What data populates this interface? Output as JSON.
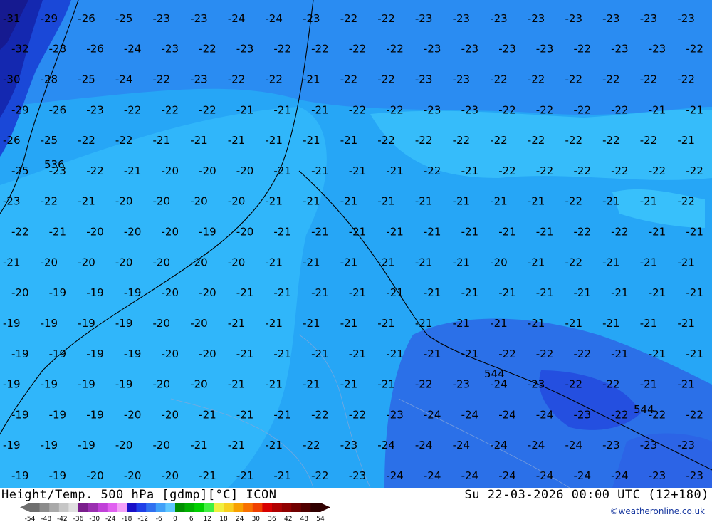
{
  "map": {
    "contour_labels": [
      [
        -31,
        -29,
        -26,
        -25,
        -23,
        -23,
        -24,
        -24,
        -23,
        -22,
        -22,
        -23,
        -23,
        -23,
        -23,
        -23,
        -23,
        -23,
        -23
      ],
      [
        -32,
        -28,
        -26,
        -24,
        -23,
        -22,
        -23,
        -22,
        -22,
        -22,
        -22,
        -23,
        -23,
        -23,
        -23,
        -22,
        -23,
        -23,
        -22
      ],
      [
        -30,
        -28,
        -25,
        -24,
        -22,
        -23,
        -22,
        -22,
        -21,
        -22,
        -22,
        -23,
        -23,
        -22,
        -22,
        -22,
        -22,
        -22,
        -22
      ],
      [
        -29,
        -26,
        -23,
        -22,
        -22,
        -22,
        -21,
        -21,
        -21,
        -22,
        -22,
        -23,
        -23,
        -22,
        -22,
        -22,
        -22,
        -21,
        -21
      ],
      [
        -26,
        -25,
        -22,
        -22,
        -21,
        -21,
        -21,
        -21,
        -21,
        -21,
        -22,
        -22,
        -22,
        -22,
        -22,
        -22,
        -22,
        -22,
        -21
      ],
      [
        -25,
        -23,
        -22,
        -21,
        -20,
        -20,
        -20,
        -21,
        -21,
        -21,
        -21,
        -22,
        -21,
        -22,
        -22,
        -22,
        -22,
        -22,
        -22
      ],
      [
        -23,
        -22,
        -21,
        -20,
        -20,
        -20,
        -20,
        -21,
        -21,
        -21,
        -21,
        -21,
        -21,
        -21,
        -21,
        -22,
        -21,
        -21,
        -22
      ],
      [
        -22,
        -21,
        -20,
        -20,
        -20,
        -19,
        -20,
        -21,
        -21,
        -21,
        -21,
        -21,
        -21,
        -21,
        -21,
        -22,
        -22,
        -21,
        -21
      ],
      [
        -21,
        -20,
        -20,
        -20,
        -20,
        -20,
        -20,
        -21,
        -21,
        -21,
        -21,
        -21,
        -21,
        -20,
        -21,
        -22,
        -21,
        -21,
        -21
      ],
      [
        -20,
        -19,
        -19,
        -19,
        -20,
        -20,
        -21,
        -21,
        -21,
        -21,
        -21,
        -21,
        -21,
        -21,
        -21,
        -21,
        -21,
        -21,
        -21
      ],
      [
        -19,
        -19,
        -19,
        -19,
        -20,
        -20,
        -21,
        -21,
        -21,
        -21,
        -21,
        -21,
        -21,
        -21,
        -21,
        -21,
        -21,
        -21,
        -21
      ],
      [
        -19,
        -19,
        -19,
        -19,
        -20,
        -20,
        -21,
        -21,
        -21,
        -21,
        -21,
        -21,
        -21,
        -22,
        -22,
        -22,
        -21,
        -21,
        -21
      ],
      [
        -19,
        -19,
        -19,
        -19,
        -20,
        -20,
        -21,
        -21,
        -21,
        -21,
        -21,
        -22,
        -23,
        -24,
        -23,
        -22,
        -22,
        -21,
        -21
      ],
      [
        -19,
        -19,
        -19,
        -20,
        -20,
        -21,
        -21,
        -21,
        -22,
        -22,
        -23,
        -24,
        -24,
        -24,
        -24,
        -23,
        -22,
        -22,
        -22
      ],
      [
        -19,
        -19,
        -19,
        -20,
        -20,
        -21,
        -21,
        -21,
        -22,
        -23,
        -24,
        -24,
        -24,
        -24,
        -24,
        -24,
        -23,
        -23,
        -23
      ],
      [
        -19,
        -19,
        -20,
        -20,
        -20,
        -21,
        -21,
        -21,
        -22,
        -23,
        -24,
        -24,
        -24,
        -24,
        -24,
        -24,
        -24,
        -23,
        -23
      ]
    ],
    "height_labels": [
      "536",
      "544",
      "544"
    ]
  },
  "footer": {
    "title_left": "Height/Temp. 500 hPa [gdmp][°C] ICON",
    "title_right": "Su 22-03-2026 00:00 UTC (12+180)",
    "credit": "©weatheronline.co.uk"
  },
  "scale": {
    "tick_labels": [
      "-54",
      "-48",
      "-42",
      "-36",
      "-30",
      "-24",
      "-18",
      "-12",
      "-6",
      "0",
      "6",
      "12",
      "18",
      "24",
      "30",
      "36",
      "42",
      "48",
      "54"
    ],
    "colors": [
      "#6f6f6f",
      "#8c8c8c",
      "#a9a9a9",
      "#c6c6c6",
      "#e0e0e0",
      "#7a1e8c",
      "#9a2fb0",
      "#c040d8",
      "#e060f0",
      "#f4a0f8",
      "#1a10c8",
      "#2040e8",
      "#3070f0",
      "#40a0f8",
      "#60c8ff",
      "#009000",
      "#00b000",
      "#00d000",
      "#40f040",
      "#f0f040",
      "#f8d020",
      "#f8a000",
      "#f87000",
      "#f04000",
      "#d80000",
      "#b00000",
      "#900000",
      "#700000",
      "#500000",
      "#300000"
    ]
  },
  "colors": {
    "ocean_light": "#2ab4f6",
    "ocean_mid": "#1e9af0",
    "ocean_dark": "#2a78ea",
    "deep_blue": "#1538d8",
    "darkest": "#1018a8"
  }
}
